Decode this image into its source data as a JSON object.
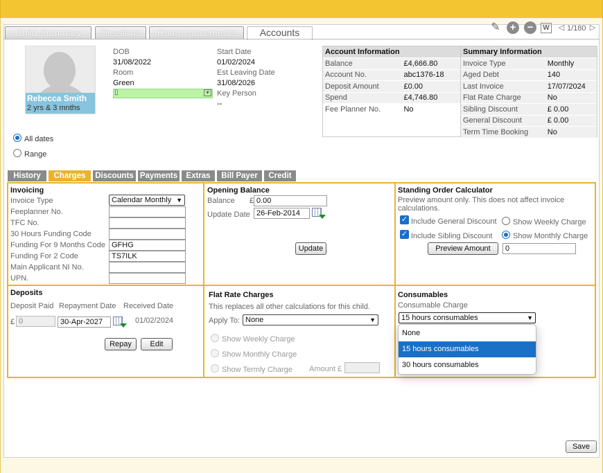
{
  "tabs": [
    "Child Summary",
    "Sessions",
    "Room Movements",
    "Accounts"
  ],
  "pager": "1/180",
  "child": {
    "name": "Rebecca Smith",
    "age": "2 yrs & 3 mnths"
  },
  "details": {
    "dob_label": "DOB",
    "dob": "31/08/2022",
    "room_label": "Room",
    "room": "Green",
    "start_label": "Start Date",
    "start": "01/02/2024",
    "leaving_label": "Est Leaving Date",
    "leaving": "31/08/2026",
    "key_label": "Key Person",
    "key": "--"
  },
  "account_info": {
    "title": "Account Information",
    "rows": [
      {
        "k": "Balance",
        "v": "£4,666.80"
      },
      {
        "k": "Account No.",
        "v": "abc1376-18"
      },
      {
        "k": "Deposit Amount",
        "v": "£0.00"
      },
      {
        "k": "Spend",
        "v": "£4,746.80"
      },
      {
        "k": "Fee Planner No.",
        "v": "No"
      }
    ]
  },
  "summary_info": {
    "title": "Summary Information",
    "rows": [
      {
        "k": "Invoice Type",
        "v": "Monthly"
      },
      {
        "k": "Aged Debt",
        "v": "140"
      },
      {
        "k": "Last Invoice",
        "v": "17/07/2024"
      },
      {
        "k": "Flat Rate Charge",
        "v": "No"
      },
      {
        "k": "Sibling Discount",
        "v": "£ 0.00"
      },
      {
        "k": "General Discount",
        "v": "£ 0.00"
      },
      {
        "k": "Term Time Booking",
        "v": "No"
      }
    ]
  },
  "date_filter": {
    "all": "All dates",
    "range": "Range"
  },
  "subtabs": [
    "History",
    "Charges",
    "Discounts",
    "Payments",
    "Extras",
    "Bill Payer",
    "Credit"
  ],
  "invoicing": {
    "title": "Invoicing",
    "labels": [
      "Invoice Type",
      "Feeplanner No.",
      "TFC No.",
      "30 Hours Funding Code",
      "Funding For 9 Months Code",
      "Funding For 2 Code",
      "Main Applicant NI No.",
      "UPN."
    ],
    "invoice_type": "Calendar Monthly",
    "values": [
      "",
      "",
      "",
      "GFHG",
      "TS7ILK",
      "",
      ""
    ]
  },
  "opening": {
    "title": "Opening Balance",
    "balance_label": "Balance",
    "currency": "£",
    "balance": "0.00",
    "update_label": "Update Date",
    "update_date": "26-Feb-2014",
    "update_btn": "Update"
  },
  "standing": {
    "title": "Standing Order Calculator",
    "note": "Preview amount only. This does not affect invoice calculations.",
    "inc_general": "Include General Discount",
    "show_weekly": "Show Weekly Charge",
    "inc_sibling": "Include Sibling Discount",
    "show_monthly": "Show Monthly Charge",
    "preview_btn": "Preview Amount",
    "preview_value": "0"
  },
  "deposits": {
    "title": "Deposits",
    "paid_label": "Deposit Paid",
    "repay_label": "Repayment Date",
    "received_label": "Received Date",
    "currency": "£",
    "paid": "0",
    "repay_date": "30-Apr-2027",
    "received": "01/02/2024",
    "repay_btn": "Repay",
    "edit_btn": "Edit"
  },
  "flat": {
    "title": "Flat Rate Charges",
    "note": "This replaces all other calculations for this child.",
    "apply_label": "Apply To:",
    "apply_value": "None",
    "weekly": "Show Weekly Charge",
    "monthly": "Show Monthly Charge",
    "termly": "Show Termly Charge",
    "amount_label": "Amount £"
  },
  "consumables": {
    "title": "Consumables",
    "charge_label": "Consumable Charge",
    "selected": "15 hours consumables",
    "options": [
      "None",
      "15 hours consumables",
      "30 hours consumables"
    ]
  },
  "save_btn": "Save"
}
